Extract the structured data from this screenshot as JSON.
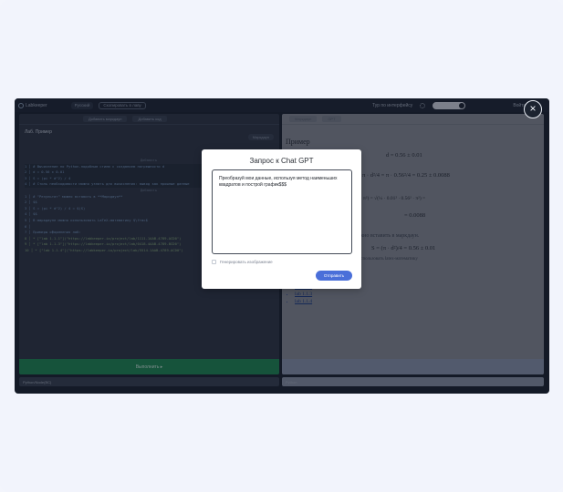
{
  "app": {
    "brand": "Labkeeper",
    "language": "Русский",
    "view_btn": "Скопировать в лаву",
    "tour": "Тур по интерфейсу",
    "user": "Войти"
  },
  "left_pane": {
    "toolbar_btn_1": "Добавить маркдаун",
    "toolbar_btn_2": "Добавить код",
    "title": "Лаб. Пример",
    "tag": "Маркдаун",
    "code_lines": [
      {
        "text": "Добавить",
        "kind": "center"
      },
      {
        "text": "1 │ # Вычисление по Python-подобным стилю с созданием погрешности d",
        "kind": "hl"
      },
      {
        "text": "2 │ d = 0.56 ± 0.01",
        "kind": "hl"
      },
      {
        "text": "3 │ S = (pi * d^2) / 4",
        "kind": "hl"
      },
      {
        "text": "4 │ # Стиль необходимости можно узнать для вычисления: вывод как прошлые данные",
        "kind": "hl"
      },
      {
        "text": "Добавить",
        "kind": "center"
      },
      {
        "text": "1 │ # \"Результат\" можно вставить в **Маркдаун**",
        "kind": "plain"
      },
      {
        "text": "2 │ $$",
        "kind": "plain"
      },
      {
        "text": "3 │ S = (pi * d^2) / 4 = $(S)",
        "kind": "plain"
      },
      {
        "text": "4 │ $$",
        "kind": "plain"
      },
      {
        "text": "5 │ В маркдауне можно использовать LaTeX-математику $\\frac$",
        "kind": "plain"
      },
      {
        "text": "6 │",
        "kind": "plain"
      },
      {
        "text": "7 │ Примеры оформления лаб:",
        "kind": "plain"
      },
      {
        "text": "8 │ * [\"lab 1.1.1\"](\"https://labkeeper.io/project/lab/1111-1AAB-4789-ACD0\")",
        "kind": "gr"
      },
      {
        "text": "9 │ * [\"lab 1.1.3\"](\"https://labkeeper.io/project/lab/0418-4AAB-4789-BCD0\")",
        "kind": "gr"
      },
      {
        "text": "10 │ * [\"lab 1.1.4\"](\"https://labkeeper.io/project/lab/5514-1AAB-4789-ACD0\")",
        "kind": "gr"
      }
    ],
    "run_label": "Выполнить  ▸",
    "status": "Python/Node(BC)"
  },
  "right_pane": {
    "toolbar_btn_1": "Маркдаун",
    "toolbar_btn_2": "GPT",
    "example": "Пример",
    "formula_d": "d  =  0.56 ± 0.01",
    "formula_s": "π · d²/4  =  π · 0.56²/4  =  0.25 ± 0.0088",
    "formula_sigma": "σ(d)² = √(¼ · σ(d)² · d² · π²) = √(¼ · 0.01² · 0.56² · π²) =",
    "formula_sigma_res": "=  0.0088",
    "note_1": "тат можно вставить в маркдаун.",
    "formula_result": "S = (π · d²)/4 = 0.56 ± 0.01",
    "note_2": "не можно использовать latex-математику",
    "links": [
      "lab 1.1.1",
      "lab 1.1.3",
      "lab 1.1.4"
    ],
    "status": "Python"
  },
  "modal": {
    "title": "Запрос к Chat GPT",
    "prompt_text": "Преобразуй мои данные, используя метод наименьших квадратов и построй график$$$",
    "checkbox_label": "Генерировать изображение",
    "send_label": "Отправить"
  },
  "close_glyph": "×"
}
